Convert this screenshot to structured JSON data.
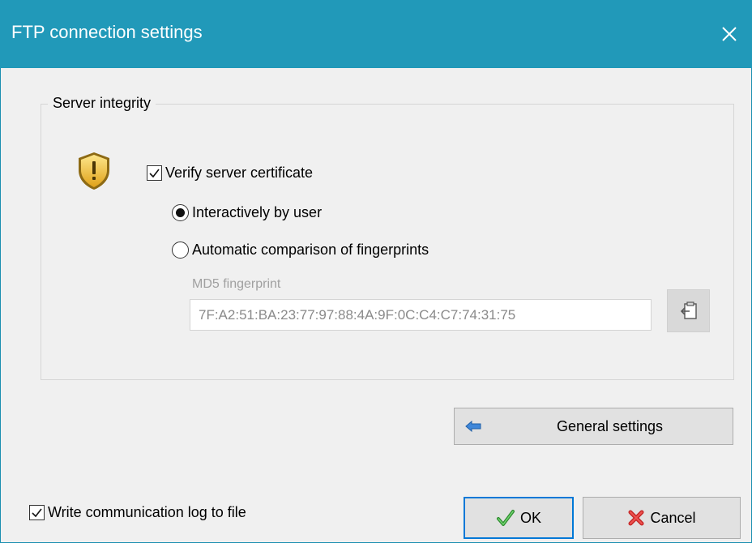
{
  "window": {
    "title": "FTP connection settings"
  },
  "server_integrity": {
    "group_title": "Server integrity",
    "verify_certificate": {
      "label": "Verify server certificate",
      "checked": true
    },
    "mode_options": [
      {
        "label": "Interactively by user",
        "selected": true
      },
      {
        "label": "Automatic comparison of fingerprints",
        "selected": false
      }
    ],
    "md5": {
      "label": "MD5 fingerprint",
      "value": "7F:A2:51:BA:23:77:97:88:4A:9F:0C:C4:C7:74:31:75"
    }
  },
  "buttons": {
    "general_settings": "General settings",
    "ok": "OK",
    "cancel": "Cancel"
  },
  "log_option": {
    "label": "Write communication log to file",
    "checked": true
  },
  "colors": {
    "titlebar": "#2199b9",
    "ok_border": "#0078d7"
  },
  "icons": {
    "close": "close-icon",
    "shield": "shield-warning-icon",
    "paste": "paste-icon",
    "back_arrow": "arrow-left-icon",
    "ok": "checkmark-icon",
    "cancel": "red-x-icon"
  }
}
